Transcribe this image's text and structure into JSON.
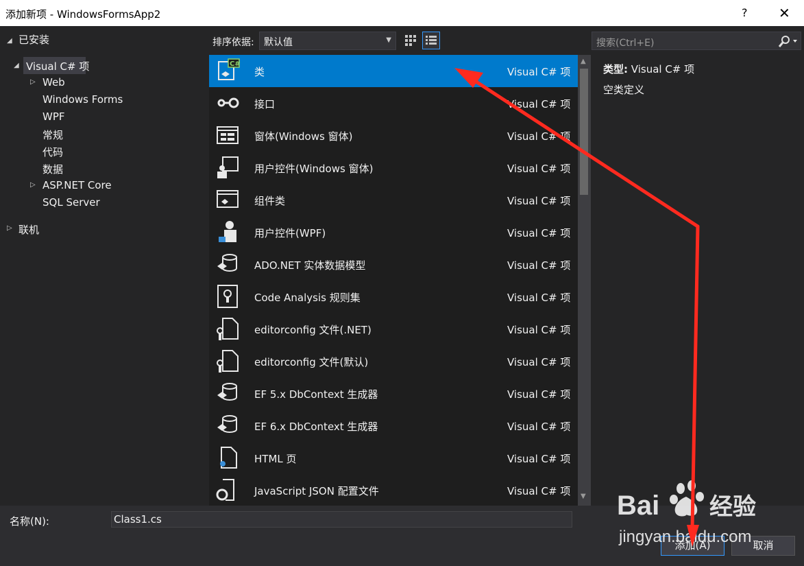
{
  "window": {
    "title": "添加新项 - WindowsFormsApp2",
    "help": "?",
    "close": "✕"
  },
  "tree": {
    "installed": "已安装",
    "visual_csharp": "Visual C# 项",
    "children": [
      "Web",
      "Windows Forms",
      "WPF",
      "常规",
      "代码",
      "数据",
      "ASP.NET Core",
      "SQL Server"
    ],
    "online": "联机"
  },
  "toolbar": {
    "sort_label": "排序依据:",
    "sort_value": "默认值"
  },
  "search": {
    "placeholder": "搜索(Ctrl+E)"
  },
  "templates": [
    {
      "name": "类",
      "type": "Visual C# 项",
      "icon": "class-icon",
      "selected": true
    },
    {
      "name": "接口",
      "type": "Visual C# 项",
      "icon": "interface-icon"
    },
    {
      "name": "窗体(Windows 窗体)",
      "type": "Visual C# 项",
      "icon": "form-icon"
    },
    {
      "name": "用户控件(Windows 窗体)",
      "type": "Visual C# 项",
      "icon": "user-control-icon"
    },
    {
      "name": "组件类",
      "type": "Visual C# 项",
      "icon": "component-icon"
    },
    {
      "name": "用户控件(WPF)",
      "type": "Visual C# 项",
      "icon": "wpf-user-control-icon"
    },
    {
      "name": "ADO.NET 实体数据模型",
      "type": "Visual C# 项",
      "icon": "data-model-icon"
    },
    {
      "name": "Code Analysis 规则集",
      "type": "Visual C# 项",
      "icon": "ruleset-icon"
    },
    {
      "name": "editorconfig 文件(.NET)",
      "type": "Visual C# 项",
      "icon": "config-file-icon"
    },
    {
      "name": "editorconfig 文件(默认)",
      "type": "Visual C# 项",
      "icon": "config-file-icon"
    },
    {
      "name": "EF 5.x DbContext 生成器",
      "type": "Visual C# 项",
      "icon": "data-model-icon"
    },
    {
      "name": "EF 6.x DbContext 生成器",
      "type": "Visual C# 项",
      "icon": "data-model-icon"
    },
    {
      "name": "HTML 页",
      "type": "Visual C# 项",
      "icon": "html-page-icon"
    },
    {
      "name": "JavaScript JSON 配置文件",
      "type": "Visual C# 项",
      "icon": "json-config-icon"
    }
  ],
  "details": {
    "type_label": "类型:",
    "type_value": "Visual C# 项",
    "description": "空类定义"
  },
  "bottom": {
    "name_label": "名称(N):",
    "name_value": "Class1.cs",
    "add_button": "添加(A)",
    "cancel_button": "取消"
  },
  "watermark": {
    "brand": "Bai",
    "brand2": "经验",
    "url": "jingyan.baidu.com"
  },
  "colors": {
    "accent": "#007acc",
    "arrow": "#ff2a1f"
  }
}
